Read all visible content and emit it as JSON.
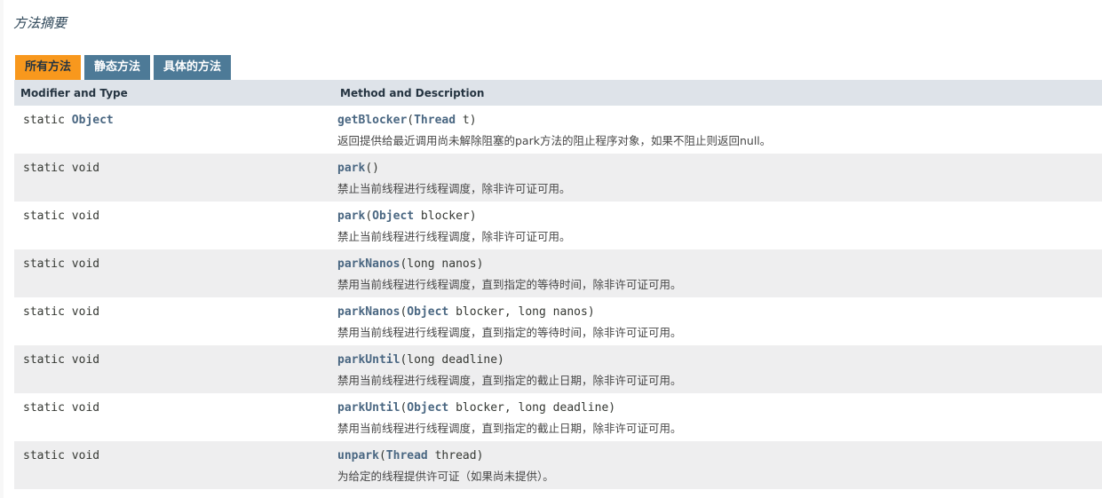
{
  "section": {
    "title": "方法摘要"
  },
  "tabs": [
    {
      "label": "所有方法",
      "active": true
    },
    {
      "label": "静态方法",
      "active": false
    },
    {
      "label": "具体的方法",
      "active": false
    }
  ],
  "columns": {
    "modifier": "Modifier and Type",
    "method": "Method and Description"
  },
  "colors": {
    "active_tab": "#f8981d",
    "inactive_tab": "#4d7a97",
    "header_bg": "#dee3e9",
    "link": "#4a6782"
  },
  "rows": [
    {
      "modifier": "static",
      "type_link": "Object",
      "type_plain": "",
      "method": "getBlocker",
      "open": "(",
      "p1_type": "Thread",
      "p1_name": " t",
      "sep": "",
      "p2_name": "",
      "close": ")",
      "desc": "返回提供给最近调用尚未解除阻塞的park方法的阻止程序对象，如果不阻止则返回null。"
    },
    {
      "modifier": "static",
      "type_link": "",
      "type_plain": "void",
      "method": "park",
      "open": "(",
      "p1_type": "",
      "p1_name": "",
      "sep": "",
      "p2_name": "",
      "close": ")",
      "desc": "禁止当前线程进行线程调度，除非许可证可用。"
    },
    {
      "modifier": "static",
      "type_link": "",
      "type_plain": "void",
      "method": "park",
      "open": "(",
      "p1_type": "Object",
      "p1_name": " blocker",
      "sep": "",
      "p2_name": "",
      "close": ")",
      "desc": "禁止当前线程进行线程调度，除非许可证可用。"
    },
    {
      "modifier": "static",
      "type_link": "",
      "type_plain": "void",
      "method": "parkNanos",
      "open": "(",
      "p1_type": "",
      "p1_name": "long nanos",
      "sep": "",
      "p2_name": "",
      "close": ")",
      "desc": "禁用当前线程进行线程调度，直到指定的等待时间，除非许可证可用。"
    },
    {
      "modifier": "static",
      "type_link": "",
      "type_plain": "void",
      "method": "parkNanos",
      "open": "(",
      "p1_type": "Object",
      "p1_name": " blocker",
      "sep": ", ",
      "p2_name": "long nanos",
      "close": ")",
      "desc": "禁用当前线程进行线程调度，直到指定的等待时间，除非许可证可用。"
    },
    {
      "modifier": "static",
      "type_link": "",
      "type_plain": "void",
      "method": "parkUntil",
      "open": "(",
      "p1_type": "",
      "p1_name": "long deadline",
      "sep": "",
      "p2_name": "",
      "close": ")",
      "desc": "禁用当前线程进行线程调度，直到指定的截止日期，除非许可证可用。"
    },
    {
      "modifier": "static",
      "type_link": "",
      "type_plain": "void",
      "method": "parkUntil",
      "open": "(",
      "p1_type": "Object",
      "p1_name": " blocker",
      "sep": ", ",
      "p2_name": "long deadline",
      "close": ")",
      "desc": "禁用当前线程进行线程调度，直到指定的截止日期，除非许可证可用。"
    },
    {
      "modifier": "static",
      "type_link": "",
      "type_plain": "void",
      "method": "unpark",
      "open": "(",
      "p1_type": "Thread",
      "p1_name": " thread",
      "sep": "",
      "p2_name": "",
      "close": ")",
      "desc": "为给定的线程提供许可证（如果尚未提供）。"
    }
  ]
}
